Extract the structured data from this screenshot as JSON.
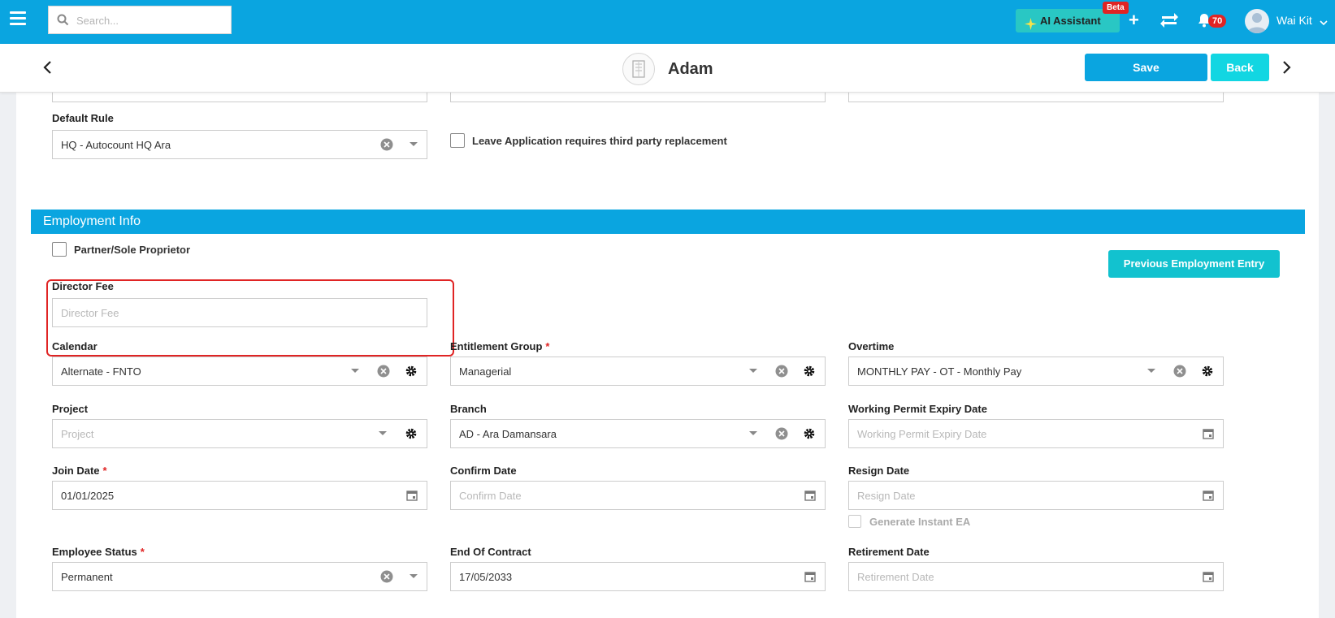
{
  "topbar": {
    "search_placeholder": "Search...",
    "ai_label": "AI Assistant",
    "beta_badge": "Beta",
    "plus_label": "+",
    "notif_count": "70",
    "user_name": "Wai Kit"
  },
  "record": {
    "name": "Adam",
    "save_label": "Save",
    "back_label": "Back"
  },
  "upper": {
    "default_rule_label": "Default Rule",
    "default_rule_value": "HQ - Autocount HQ Ara",
    "leave_replacement_label": "Leave Application requires third party replacement"
  },
  "section": {
    "title": "Employment Info",
    "partner_label": "Partner/Sole Proprietor",
    "prev_employment_label": "Previous Employment Entry"
  },
  "fields": {
    "director_fee": {
      "label": "Director Fee",
      "placeholder": "Director Fee"
    },
    "calendar": {
      "label": "Calendar",
      "value": "Alternate - FNTO"
    },
    "entitlement_group": {
      "label": "Entitlement Group",
      "value": "Managerial",
      "required": "*"
    },
    "overtime": {
      "label": "Overtime",
      "value": "MONTHLY PAY - OT - Monthly Pay"
    },
    "project": {
      "label": "Project",
      "placeholder": "Project"
    },
    "branch": {
      "label": "Branch",
      "value": "AD - Ara Damansara"
    },
    "working_permit": {
      "label": "Working Permit Expiry Date",
      "placeholder": "Working Permit Expiry Date"
    },
    "join_date": {
      "label": "Join Date",
      "value": "01/01/2025",
      "required": "*"
    },
    "confirm_date": {
      "label": "Confirm Date",
      "placeholder": "Confirm Date"
    },
    "resign_date": {
      "label": "Resign Date",
      "placeholder": "Resign Date"
    },
    "generate_ea": {
      "label": "Generate Instant EA"
    },
    "employee_status": {
      "label": "Employee Status",
      "value": "Permanent",
      "required": "*"
    },
    "end_of_contract": {
      "label": "End Of Contract",
      "value": "17/05/2033"
    },
    "retirement_date": {
      "label": "Retirement Date",
      "placeholder": "Retirement Date"
    }
  },
  "colors": {
    "primary": "#0aa5e0",
    "teal": "#12d6e2",
    "danger": "#e02424"
  }
}
